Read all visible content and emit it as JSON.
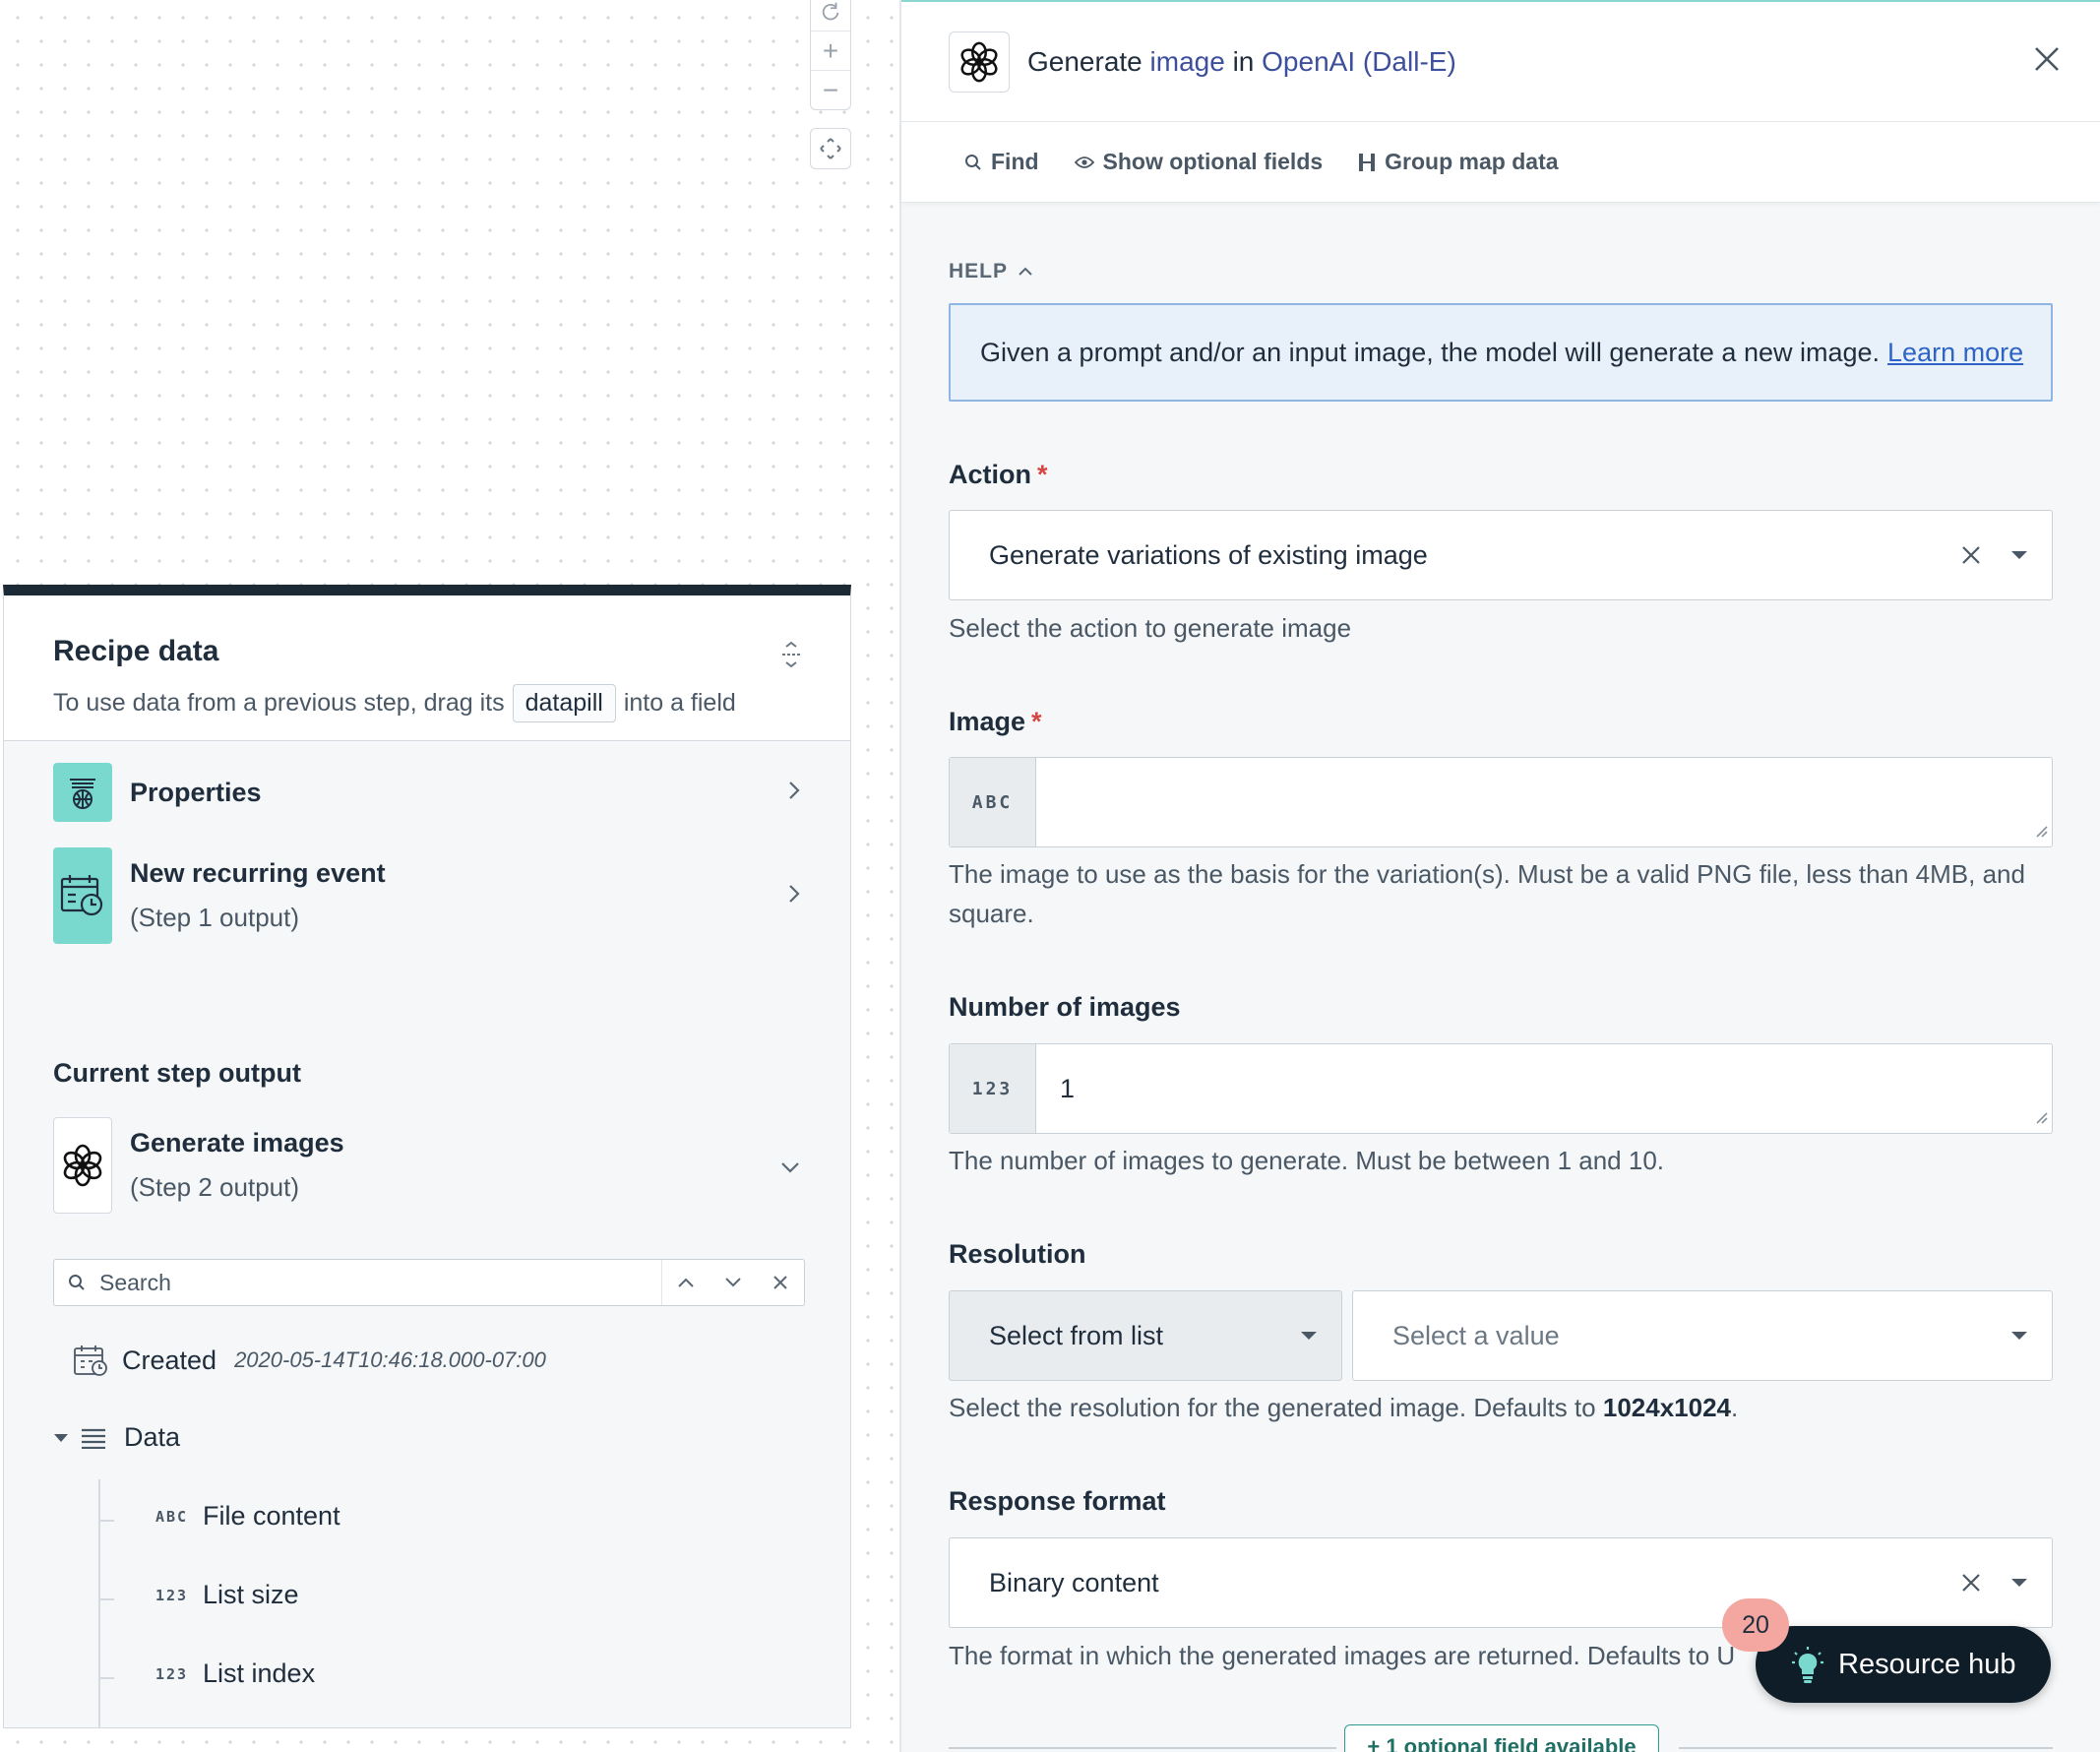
{
  "canvas": {
    "zoom_in_label": "+",
    "zoom_out_label": "−"
  },
  "recipe": {
    "title": "Recipe data",
    "subtitle_before": "To use data from a previous step, drag its",
    "subtitle_pill": "datapill",
    "subtitle_after": "into a field",
    "items": [
      {
        "name": "Properties",
        "step": ""
      },
      {
        "name": "New recurring event",
        "step": "(Step 1 output)"
      }
    ],
    "current_step_label": "Current step output",
    "current_step": {
      "name": "Generate images",
      "step": "(Step 2 output)"
    },
    "search_placeholder": "Search",
    "created_label": "Created",
    "created_value": "2020-05-14T10:46:18.000-07:00",
    "data_label": "Data",
    "data_children": [
      {
        "type": "ABC",
        "label": "File content"
      },
      {
        "type": "123",
        "label": "List size"
      },
      {
        "type": "123",
        "label": "List index"
      }
    ]
  },
  "panel": {
    "title_pre": "Generate",
    "title_obj": "image",
    "title_mid": "in",
    "title_app": "OpenAI (Dall-E)",
    "toolbar": {
      "find": "Find",
      "show_optional": "Show optional fields",
      "group_map": "Group map data"
    },
    "help_label": "HELP",
    "help_text": "Given a prompt and/or an input image, the model will generate a new image.",
    "help_link": "Learn more",
    "action": {
      "label": "Action",
      "value": "Generate variations of existing image",
      "hint": "Select the action to generate image"
    },
    "image": {
      "label": "Image",
      "type_tag": "ABC",
      "value": "",
      "hint": "The image to use as the basis for the variation(s). Must be a valid PNG file, less than 4MB, and square."
    },
    "num_images": {
      "label": "Number of images",
      "type_tag": "123",
      "value": "1",
      "hint": "The number of images to generate. Must be between 1 and 10."
    },
    "resolution": {
      "label": "Resolution",
      "mode": "Select from list",
      "placeholder": "Select a value",
      "hint_pre": "Select the resolution for the generated image. Defaults to",
      "hint_bold": "1024x1024",
      "hint_post": "."
    },
    "response_format": {
      "label": "Response format",
      "value": "Binary content",
      "hint": "The format in which the generated images are returned. Defaults to UR"
    },
    "optional_fields": "+ 1 optional field available"
  },
  "resource_hub": {
    "label": "Resource hub",
    "badge": "20"
  },
  "colors": {
    "accent_teal": "#7ad9cf",
    "link_blue": "#2e64c8",
    "title_highlight": "#3d4f9c",
    "required_red": "#d64541",
    "dark_navy": "#0f1d28",
    "badge_pink": "#f4a7a0"
  }
}
